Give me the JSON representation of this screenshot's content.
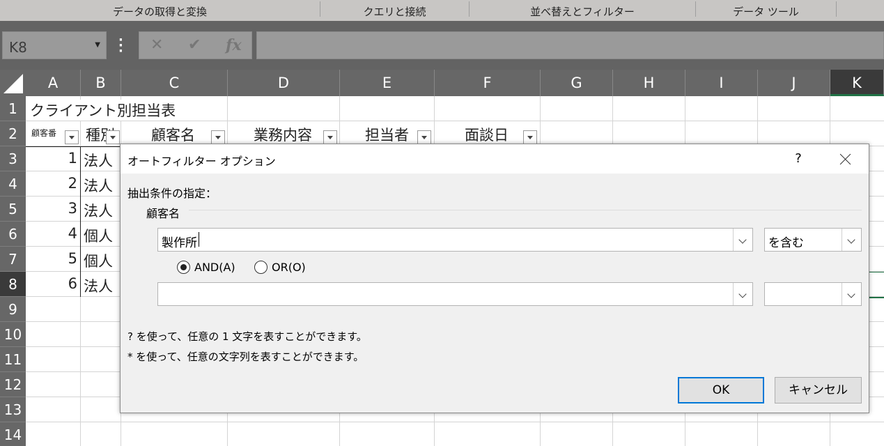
{
  "ribbon": {
    "groups": [
      "データの取得と変換",
      "クエリと接続",
      "並べ替えとフィルター",
      "データ ツール"
    ]
  },
  "formula_bar": {
    "name_box": "K8",
    "cancel_glyph": "✕",
    "enter_glyph": "✔",
    "fx_label": "fx",
    "formula": ""
  },
  "grid": {
    "columns": [
      "A",
      "B",
      "C",
      "D",
      "E",
      "F",
      "G",
      "H",
      "I",
      "J",
      "K"
    ],
    "active_column": "K",
    "rows": [
      "1",
      "2",
      "3",
      "4",
      "5",
      "6",
      "7",
      "8",
      "9",
      "10",
      "11",
      "12",
      "13",
      "14"
    ],
    "active_row": "8",
    "title": "クライアント別担当表",
    "headers": {
      "a": "顧客番",
      "b": "種別",
      "c": "顧客名",
      "d": "業務内容",
      "e": "担当者",
      "f": "面談日"
    },
    "records": [
      {
        "no": "1",
        "type": "法人"
      },
      {
        "no": "2",
        "type": "法人"
      },
      {
        "no": "3",
        "type": "法人"
      },
      {
        "no": "4",
        "type": "個人"
      },
      {
        "no": "5",
        "type": "個人"
      },
      {
        "no": "6",
        "type": "法人"
      }
    ]
  },
  "dialog": {
    "title": "オートフィルター オプション",
    "help": "?",
    "condition_label": "抽出条件の指定：",
    "field_name": "顧客名",
    "criteria1_value": "製作所",
    "operator1": "を含む",
    "criteria2_value": "",
    "operator2": "",
    "and_label": "AND(A)",
    "or_label": "OR(O)",
    "and_selected": true,
    "hint1": "? を使って、任意の 1 文字を表すことができます。",
    "hint2": "* を使って、任意の文字列を表すことができます。",
    "ok_label": "OK",
    "cancel_label": "キャンセル",
    "accent_color": "#0078d7"
  }
}
